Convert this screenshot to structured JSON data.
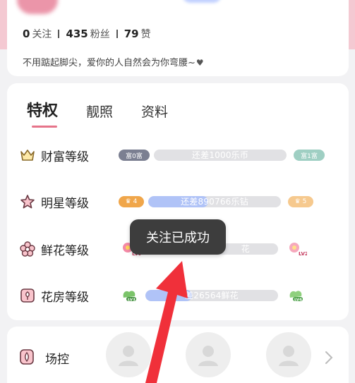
{
  "profile": {
    "following_count": "0",
    "following_label": "关注",
    "fans_count": "435",
    "fans_label": "粉丝",
    "likes_count": "79",
    "likes_label": "赞",
    "bio": "不用踮起脚尖，爱你的人自然会为你弯腰~"
  },
  "tabs": [
    {
      "label": "特权",
      "active": true
    },
    {
      "label": "靓照",
      "active": false
    },
    {
      "label": "资料",
      "active": false
    }
  ],
  "levels": [
    {
      "label": "财富等级",
      "icon": "crown-icon",
      "current_badge": "富0富",
      "progress_text": "还差1000乐币",
      "progress": 0.0,
      "next_badge": "富1富"
    },
    {
      "label": "明星等级",
      "icon": "star-icon",
      "current_badge": "4",
      "progress_text": "还差890766乐钻",
      "progress": 0.45,
      "next_badge": "5"
    },
    {
      "label": "鲜花等级",
      "icon": "flower-icon",
      "current_badge": "LV1",
      "progress_text": "花",
      "progress": 0.0,
      "next_badge": "LV2"
    },
    {
      "label": "花房等级",
      "icon": "flowerhouse-icon",
      "current_badge": "LV3",
      "progress_text": "差26564鲜花",
      "progress": 0.35,
      "next_badge": "LV4"
    }
  ],
  "toast": {
    "text": "关注已成功"
  },
  "field_control": {
    "label": "场控"
  },
  "colors": {
    "accent_pink": "#e6748a",
    "progress_blue": "#b0c3f7",
    "arrow_red": "#f0303a",
    "gold": "#f0b84a"
  }
}
